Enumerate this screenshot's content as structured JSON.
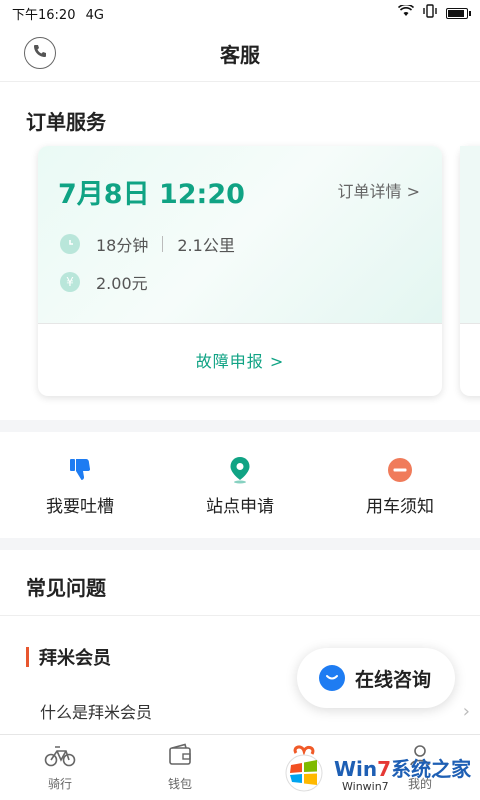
{
  "status_bar": {
    "time": "下午16:20",
    "network": "4G"
  },
  "header": {
    "title": "客服"
  },
  "order_section": {
    "title": "订单服务",
    "card": {
      "date_time": "7月8日  12:20",
      "detail_link": "订单详情  >",
      "duration": "18分钟",
      "distance": "2.1公里",
      "cost": "2.00元",
      "fault_report": "故障申报 >"
    }
  },
  "actions": [
    {
      "label": "我要吐槽",
      "icon": "thumbs-down-icon",
      "color": "#1e7cf2"
    },
    {
      "label": "站点申请",
      "icon": "location-pin-icon",
      "color": "#10a384"
    },
    {
      "label": "用车须知",
      "icon": "minus-circle-icon",
      "color": "#f07b5a"
    }
  ],
  "faq": {
    "title": "常见问题",
    "category": "拜米会员",
    "items": [
      "什么是拜米会员"
    ]
  },
  "consult_button": {
    "label": "在线咨询"
  },
  "tabs": [
    {
      "label": "骑行",
      "icon": "bike-icon"
    },
    {
      "label": "钱包",
      "icon": "wallet-icon"
    },
    {
      "label": "",
      "icon": ""
    },
    {
      "label": "我的",
      "icon": "user-icon"
    }
  ],
  "watermark": {
    "brand_a": "Win",
    "brand_b": "7",
    "brand_c": "系统之家",
    "url": "Winwin7"
  }
}
